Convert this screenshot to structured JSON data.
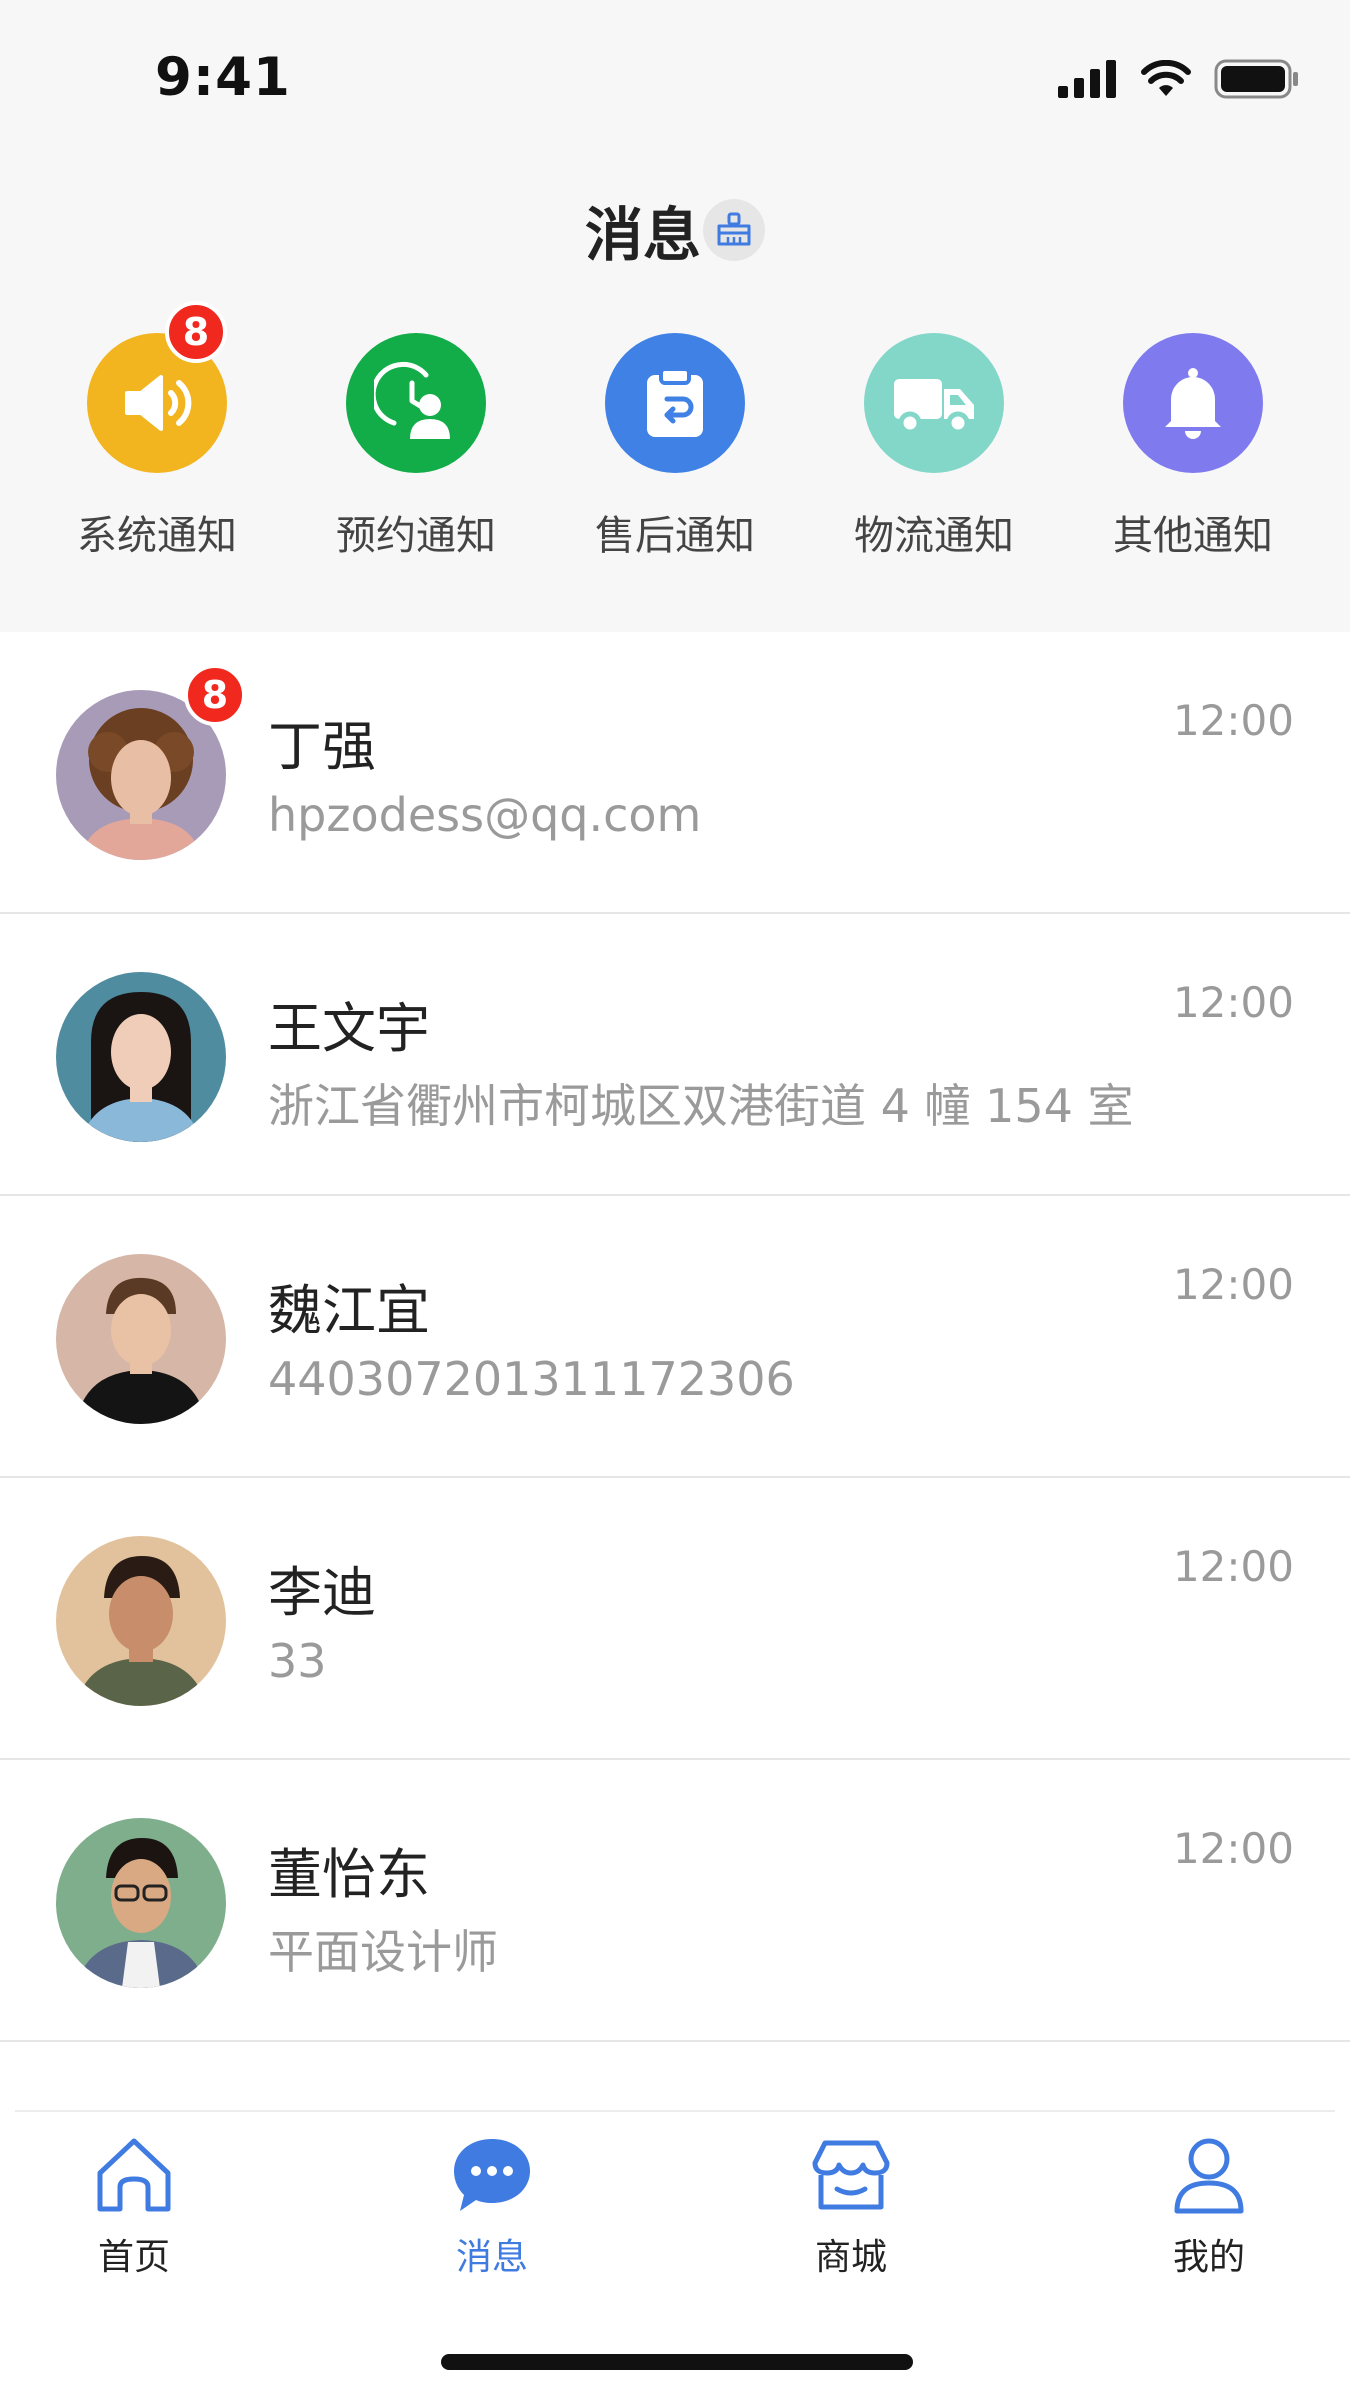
{
  "status_bar": {
    "time": "9:41",
    "icons": [
      "signal-icon",
      "wifi-icon",
      "battery-icon"
    ]
  },
  "header": {
    "title": "消息",
    "clean_icon": "broom-icon"
  },
  "categories": [
    {
      "label": "系统通知",
      "icon": "speaker-icon",
      "color": "#f2b51f",
      "badge": "8"
    },
    {
      "label": "预约通知",
      "icon": "appointment-icon",
      "color": "#12ad49",
      "badge": null
    },
    {
      "label": "售后通知",
      "icon": "return-icon",
      "color": "#4081e6",
      "badge": null
    },
    {
      "label": "物流通知",
      "icon": "truck-icon",
      "color": "#82d7c8",
      "badge": null
    },
    {
      "label": "其他通知",
      "icon": "bell-icon",
      "color": "#7f7bef",
      "badge": null
    }
  ],
  "contacts": [
    {
      "name": "丁强",
      "subtitle": "hpzodess@qq.com",
      "time": "12:00",
      "badge": "8"
    },
    {
      "name": "王文宇",
      "subtitle": "浙江省衢州市柯城区双港街道 4 幢 154 室",
      "time": "12:00",
      "badge": null
    },
    {
      "name": "魏江宜",
      "subtitle": "440307201311172306",
      "time": "12:00",
      "badge": null
    },
    {
      "name": "李迪",
      "subtitle": "33",
      "time": "12:00",
      "badge": null
    },
    {
      "name": "董怡东",
      "subtitle": "平面设计师",
      "time": "12:00",
      "badge": null
    }
  ],
  "tabs": [
    {
      "label": "首页",
      "icon": "home-icon",
      "active": false
    },
    {
      "label": "消息",
      "icon": "chat-icon",
      "active": true
    },
    {
      "label": "商城",
      "icon": "store-icon",
      "active": false
    },
    {
      "label": "我的",
      "icon": "user-icon",
      "active": false
    }
  ],
  "colors": {
    "accent": "#3f7be0",
    "badge": "#f0281e",
    "header_bg": "#f7f7f7"
  }
}
